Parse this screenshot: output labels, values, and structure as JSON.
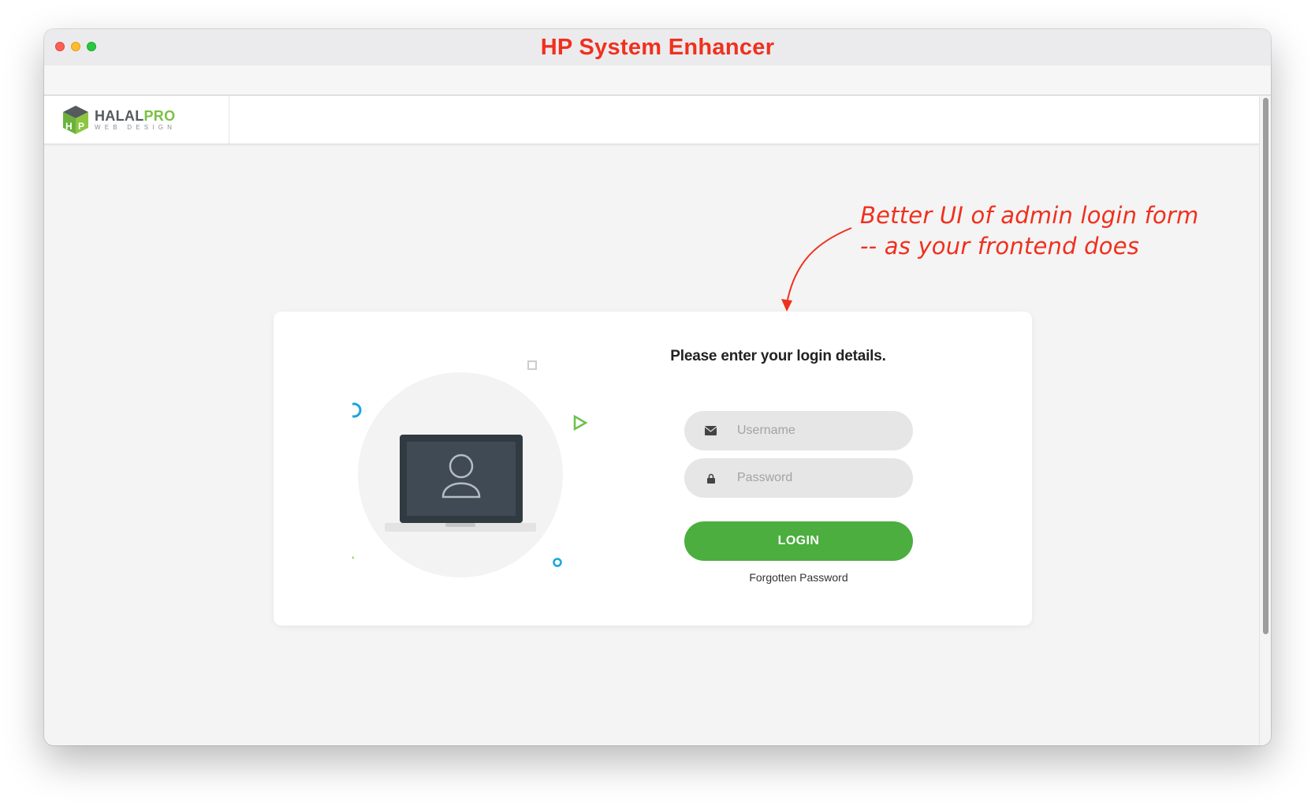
{
  "window": {
    "title": "HP System Enhancer"
  },
  "header": {
    "logo_main": "HALAL",
    "logo_accent": "PRO",
    "logo_sub": "WEB DESIGN"
  },
  "annotation": {
    "line1": "Better UI of admin login form",
    "line2": "-- as your frontend does"
  },
  "login": {
    "heading": "Please enter your login details.",
    "username_placeholder": "Username",
    "password_placeholder": "Password",
    "login_label": "LOGIN",
    "forgot_label": "Forgotten Password"
  },
  "colors": {
    "annotation": "#f0301e",
    "login_button": "#4bae3f",
    "accent_green": "#7ac043",
    "accent_blue": "#1aa5e0"
  }
}
